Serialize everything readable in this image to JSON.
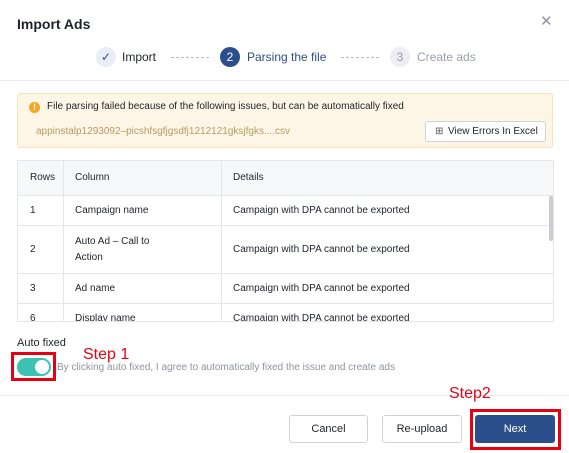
{
  "dialog": {
    "title": "Import Ads",
    "close_icon": "close-icon"
  },
  "steps": [
    {
      "marker": "✓",
      "label": "Import",
      "state": "done"
    },
    {
      "marker": "2",
      "label": "Parsing the file",
      "state": "active"
    },
    {
      "marker": "3",
      "label": "Create ads",
      "state": "pending"
    }
  ],
  "alert": {
    "icon": "warning-icon",
    "message": "File parsing failed because of the following issues, but can be automatically fixed",
    "file_name": "appinstalp1293092–picshfsgfjgsdfj1212121gksjfgks....csv",
    "view_errors_label": "View Errors In Excel",
    "view_errors_icon": "excel-icon"
  },
  "table": {
    "headers": [
      "Rows",
      "Column",
      "Details"
    ],
    "rows": [
      {
        "row": "1",
        "column": "Campaign name",
        "details": "Campaign with DPA cannot be exported"
      },
      {
        "row": "2",
        "column": "Auto Ad – Call to Action",
        "details": "Campaign with DPA cannot be exported"
      },
      {
        "row": "3",
        "column": "Ad name",
        "details": "Campaign with DPA cannot be exported"
      },
      {
        "row": "6",
        "column": "Display name",
        "details": "Campaign with DPA cannot be exported"
      }
    ]
  },
  "auto_fix": {
    "label": "Auto fixed",
    "enabled": true,
    "hint": "By clicking auto fixed,  I agree to automatically fixed the issue and create ads"
  },
  "annotations": {
    "step1": "Step 1",
    "step2": "Step2",
    "highlight_color": "#e60012"
  },
  "footer": {
    "cancel_label": "Cancel",
    "reupload_label": "Re-upload",
    "next_label": "Next"
  },
  "colors": {
    "primary": "#2b4f8a",
    "toggle_on": "#3cc2b2",
    "warning": "#f5a623"
  }
}
